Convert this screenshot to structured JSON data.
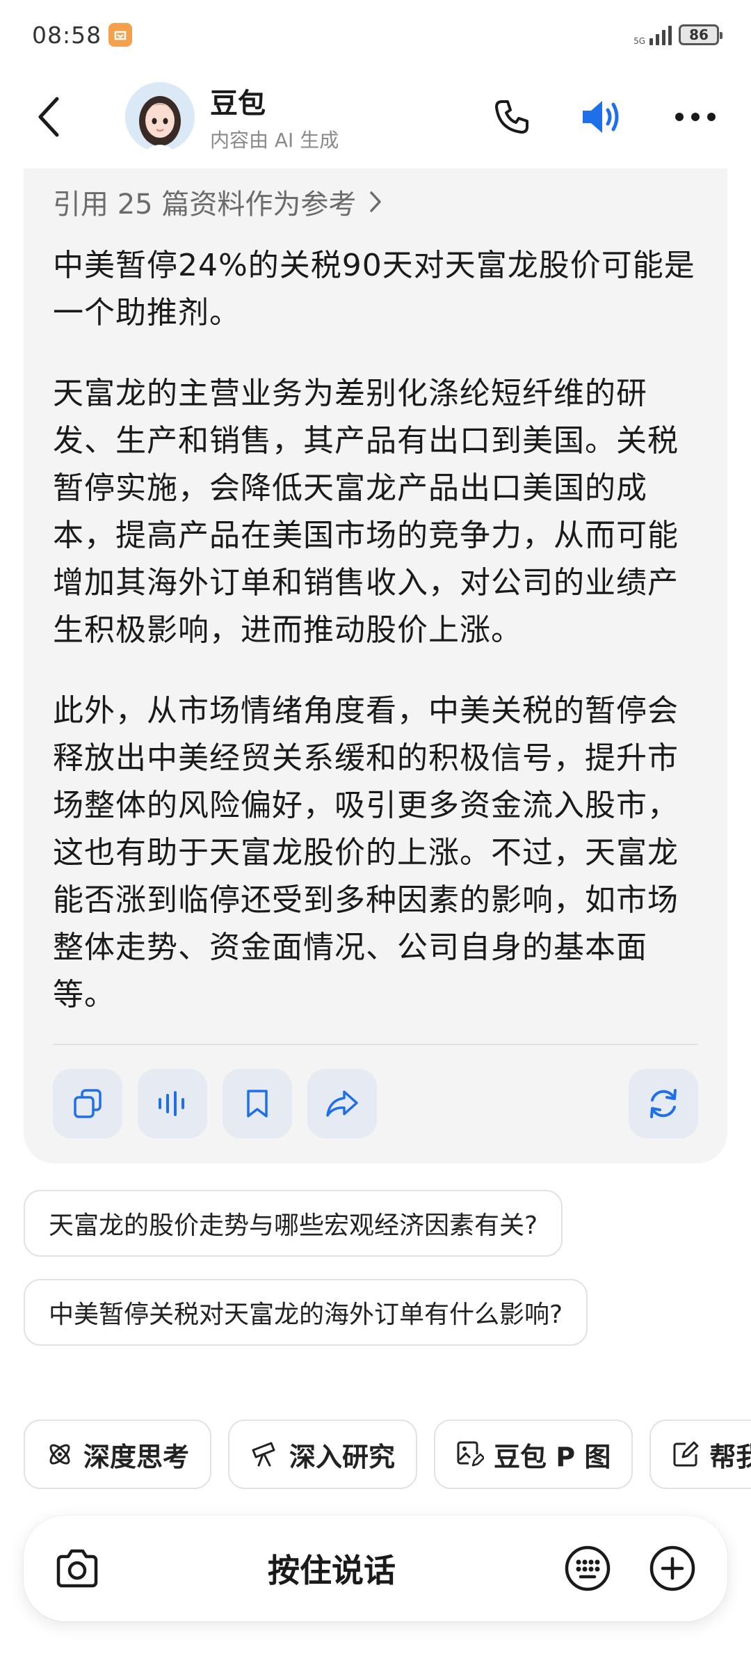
{
  "status_bar": {
    "time": "08:58",
    "network": "5G",
    "battery": "86"
  },
  "header": {
    "name": "豆包",
    "subtitle": "内容由 AI 生成"
  },
  "answer": {
    "references": "引用 25 篇资料作为参考",
    "paragraphs": [
      "中美暂停24%的关税90天对天富龙股价可能是一个助推剂。",
      "天富龙的主营业务为差别化涤纶短纤维的研发、生产和销售，其产品有出口到美国。关税暂停实施，会降低天富龙产品出口美国的成本，提高产品在美国市场的竞争力，从而可能增加其海外订单和销售收入，对公司的业绩产生积极影响，进而推动股价上涨。",
      "此外，从市场情绪角度看，中美关税的暂停会释放出中美经贸关系缓和的积极信号，提升市场整体的风险偏好，吸引更多资金流入股市，这也有助于天富龙股价的上涨。不过，天富龙能否涨到临停还受到多种因素的影响，如市场整体走势、资金面情况、公司自身的基本面等。"
    ]
  },
  "suggestions": [
    "天富龙的股价走势与哪些宏观经济因素有关?",
    "中美暂停关税对天富龙的海外订单有什么影响?"
  ],
  "chips": [
    {
      "label": "深度思考",
      "icon": "atom-icon"
    },
    {
      "label": "深入研究",
      "icon": "telescope-icon"
    },
    {
      "label": "豆包 P 图",
      "icon": "image-edit-icon"
    },
    {
      "label": "帮我",
      "icon": "edit-icon"
    }
  ],
  "input_bar": {
    "hold_to_talk": "按住说话"
  },
  "colors": {
    "accent_blue": "#1f6feb",
    "card_bg": "#f4f4f5",
    "action_btn_bg": "#e6eaf2"
  }
}
